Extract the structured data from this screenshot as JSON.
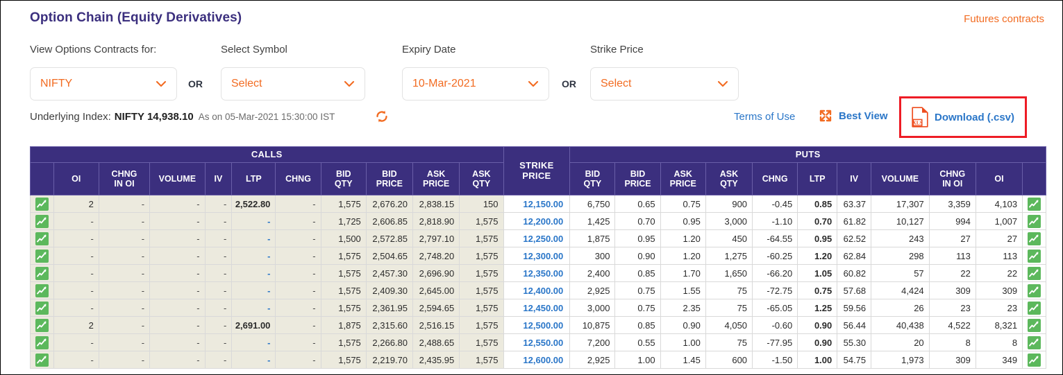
{
  "header": {
    "title": "Option Chain (Equity Derivatives)",
    "futures_link": "Futures contracts"
  },
  "filters": {
    "view_label": "View Options Contracts for:",
    "view_value": "NIFTY",
    "or_1": "OR",
    "symbol_label": "Select Symbol",
    "symbol_value": "Select",
    "expiry_label": "Expiry Date",
    "expiry_value": "10-Mar-2021",
    "or_2": "OR",
    "strike_label": "Strike Price",
    "strike_value": "Select"
  },
  "underlying": {
    "lead": "Underlying Index:",
    "value": "NIFTY 14,938.10",
    "as_on": "As on 05-Mar-2021 15:30:00 IST",
    "refresh_icon": "refresh-icon"
  },
  "actions": {
    "terms": "Terms of Use",
    "best_view": "Best View",
    "best_view_icon": "expand-icon",
    "download": "Download (.csv)",
    "download_icon": "xls-file-icon",
    "highlight_color": "#ee1c25"
  },
  "colors": {
    "brand_purple": "#3b2f7e",
    "orange": "#f26b21",
    "link_blue": "#2a76c8",
    "negative_red": "#e02020",
    "calls_bg": "#eceade"
  },
  "table": {
    "group_calls": "CALLS",
    "group_puts": "PUTS",
    "call_headers": [
      "OI",
      "CHNG IN OI",
      "VOLUME",
      "IV",
      "LTP",
      "CHNG",
      "BID QTY",
      "BID PRICE",
      "ASK PRICE",
      "ASK QTY"
    ],
    "strike_header": "STRIKE PRICE",
    "put_headers": [
      "BID QTY",
      "BID PRICE",
      "ASK PRICE",
      "ASK QTY",
      "CHNG",
      "LTP",
      "IV",
      "VOLUME",
      "CHNG IN OI",
      "OI"
    ],
    "row_icon": "chart-icon",
    "rows": [
      {
        "calls": [
          "2",
          "-",
          "-",
          "-",
          "2,522.80",
          "-",
          "1,575",
          "2,676.20",
          "2,838.15",
          "150"
        ],
        "strike": "12,150.00",
        "puts": [
          "6,750",
          "0.65",
          "0.75",
          "900",
          "-0.45",
          "0.85",
          "63.37",
          "17,307",
          "3,359",
          "4,103"
        ]
      },
      {
        "calls": [
          "-",
          "-",
          "-",
          "-",
          "-",
          "-",
          "1,725",
          "2,606.85",
          "2,818.90",
          "1,575"
        ],
        "strike": "12,200.00",
        "puts": [
          "1,425",
          "0.70",
          "0.95",
          "3,000",
          "-1.10",
          "0.70",
          "61.82",
          "10,127",
          "994",
          "1,007"
        ]
      },
      {
        "calls": [
          "-",
          "-",
          "-",
          "-",
          "-",
          "-",
          "1,500",
          "2,572.85",
          "2,797.10",
          "1,575"
        ],
        "strike": "12,250.00",
        "puts": [
          "1,875",
          "0.95",
          "1.20",
          "450",
          "-64.55",
          "0.95",
          "62.52",
          "243",
          "27",
          "27"
        ]
      },
      {
        "calls": [
          "-",
          "-",
          "-",
          "-",
          "-",
          "-",
          "1,575",
          "2,504.65",
          "2,748.20",
          "1,575"
        ],
        "strike": "12,300.00",
        "puts": [
          "300",
          "0.90",
          "1.20",
          "1,275",
          "-60.25",
          "1.20",
          "62.84",
          "298",
          "113",
          "113"
        ]
      },
      {
        "calls": [
          "-",
          "-",
          "-",
          "-",
          "-",
          "-",
          "1,575",
          "2,457.30",
          "2,696.90",
          "1,575"
        ],
        "strike": "12,350.00",
        "puts": [
          "2,400",
          "0.85",
          "1.70",
          "1,650",
          "-66.20",
          "1.05",
          "60.82",
          "57",
          "22",
          "22"
        ]
      },
      {
        "calls": [
          "-",
          "-",
          "-",
          "-",
          "-",
          "-",
          "1,575",
          "2,409.30",
          "2,645.00",
          "1,575"
        ],
        "strike": "12,400.00",
        "puts": [
          "2,925",
          "0.75",
          "1.55",
          "75",
          "-72.75",
          "0.75",
          "57.68",
          "4,424",
          "309",
          "309"
        ]
      },
      {
        "calls": [
          "-",
          "-",
          "-",
          "-",
          "-",
          "-",
          "1,575",
          "2,361.95",
          "2,594.65",
          "1,575"
        ],
        "strike": "12,450.00",
        "puts": [
          "3,000",
          "0.75",
          "2.35",
          "75",
          "-65.05",
          "1.25",
          "59.56",
          "26",
          "23",
          "23"
        ]
      },
      {
        "calls": [
          "2",
          "-",
          "-",
          "-",
          "2,691.00",
          "-",
          "1,875",
          "2,315.60",
          "2,516.15",
          "1,575"
        ],
        "strike": "12,500.00",
        "puts": [
          "10,875",
          "0.85",
          "0.90",
          "4,050",
          "-0.60",
          "0.90",
          "56.44",
          "40,438",
          "4,522",
          "8,321"
        ]
      },
      {
        "calls": [
          "-",
          "-",
          "-",
          "-",
          "-",
          "-",
          "1,575",
          "2,266.80",
          "2,488.65",
          "1,575"
        ],
        "strike": "12,550.00",
        "puts": [
          "7,200",
          "0.55",
          "1.00",
          "75",
          "-77.95",
          "0.90",
          "55.30",
          "20",
          "8",
          "8"
        ]
      },
      {
        "calls": [
          "-",
          "-",
          "-",
          "-",
          "-",
          "-",
          "1,575",
          "2,219.70",
          "2,435.95",
          "1,575"
        ],
        "strike": "12,600.00",
        "puts": [
          "2,925",
          "1.00",
          "1.45",
          "600",
          "-1.50",
          "1.00",
          "54.75",
          "1,973",
          "309",
          "349"
        ]
      }
    ]
  }
}
